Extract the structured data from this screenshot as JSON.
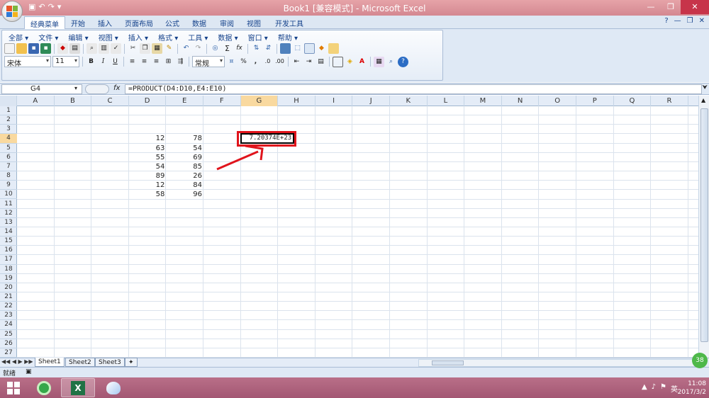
{
  "window": {
    "title": "Book1  [兼容模式] - Microsoft Excel",
    "min": "—",
    "max": "❐",
    "close": "✕"
  },
  "tabs": [
    {
      "label": "经典菜单",
      "active": true
    },
    {
      "label": "开始"
    },
    {
      "label": "插入"
    },
    {
      "label": "页面布局"
    },
    {
      "label": "公式"
    },
    {
      "label": "数据"
    },
    {
      "label": "审阅"
    },
    {
      "label": "视图"
    },
    {
      "label": "开发工具"
    }
  ],
  "menus": [
    {
      "label": "全部 ▾"
    },
    {
      "label": "文件 ▾"
    },
    {
      "label": "编辑 ▾"
    },
    {
      "label": "视图 ▾"
    },
    {
      "label": "插入 ▾"
    },
    {
      "label": "格式 ▾"
    },
    {
      "label": "工具 ▾"
    },
    {
      "label": "数据 ▾"
    },
    {
      "label": "窗口 ▾"
    },
    {
      "label": "帮助 ▾"
    }
  ],
  "toolbar": {
    "font": "宋体",
    "size": "11",
    "bold": "B",
    "italic": "I",
    "underline": "U",
    "number_format": "常规",
    "percent": "%",
    "comma": ",",
    "sigma": "Σ",
    "fx": "fx"
  },
  "formula_bar": {
    "name_box": "G4",
    "fx_label": "fx",
    "formula": "=PRODUCT(D4:D10,E4:E10)"
  },
  "columns": [
    "A",
    "B",
    "C",
    "D",
    "E",
    "F",
    "G",
    "H",
    "I",
    "J",
    "K",
    "L",
    "M",
    "N",
    "O",
    "P",
    "Q",
    "R"
  ],
  "selected_column": "G",
  "rows": [
    "1",
    "2",
    "3",
    "4",
    "5",
    "6",
    "7",
    "8",
    "9",
    "10",
    "11",
    "12",
    "13",
    "14",
    "15",
    "16",
    "17",
    "18",
    "19",
    "20",
    "21",
    "22",
    "23",
    "24",
    "25",
    "26",
    "27"
  ],
  "selected_row": "4",
  "data": {
    "D": [
      "12",
      "63",
      "55",
      "54",
      "89",
      "12",
      "58"
    ],
    "E": [
      "78",
      "54",
      "69",
      "85",
      "26",
      "84",
      "96"
    ]
  },
  "active_cell": {
    "ref": "G4",
    "value": "7.20374E+23"
  },
  "sheets": [
    {
      "label": "Sheet1",
      "active": true
    },
    {
      "label": "Sheet2"
    },
    {
      "label": "Sheet3"
    }
  ],
  "status": {
    "ready": "就绪",
    "zoom": "38"
  },
  "taskbar": {
    "tray": [
      "▲",
      "♪",
      "⚑",
      "英"
    ],
    "ime": "英",
    "time": "11:08",
    "date": "2017/3/2"
  },
  "colors": {
    "highlight": "#e0141c",
    "selected_header": "#f9d99f"
  }
}
